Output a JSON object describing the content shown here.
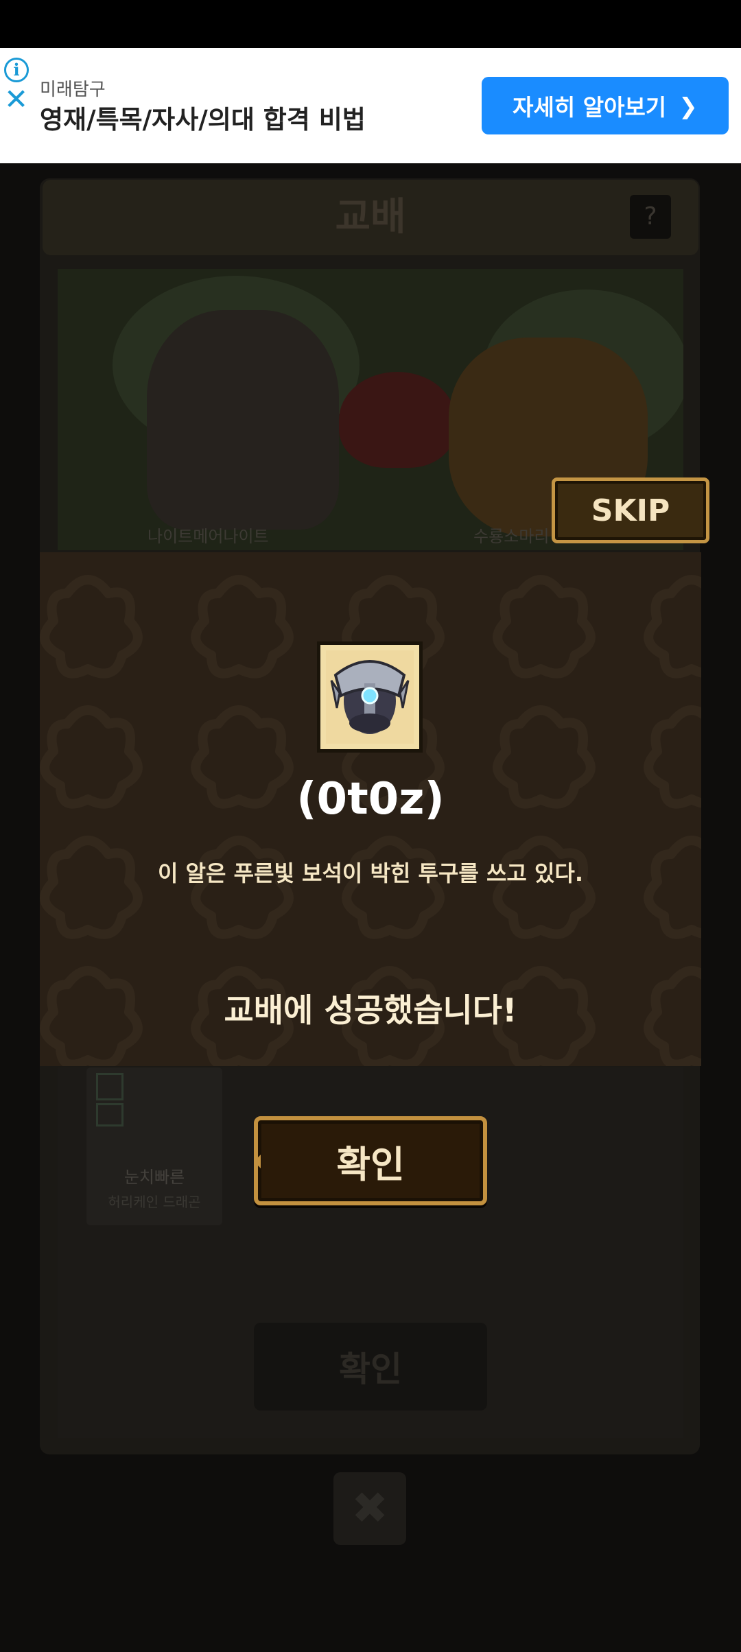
{
  "ad": {
    "sponsor": "미래탐구",
    "headline": "영재/특목/자사/의대 합격 비법",
    "cta": "자세히 알아보기",
    "info_icon": "info-icon",
    "close_icon": "close-icon"
  },
  "background": {
    "title": "교배",
    "help": "?",
    "parent1": "나이트메어나이트",
    "parent2": "수룡소마리",
    "child_name": "눈치빠른",
    "child_type": "허리케인 드래곤",
    "confirm_disabled": "확인",
    "close": "✖"
  },
  "skip": "SKIP",
  "modal": {
    "item_icon": "armored-egg-icon",
    "egg_name": "(0t0z)",
    "description": "이 알은 푸른빛 보석이 박힌 투구를 쓰고 있다.",
    "result": "교배에 성공했습니다!"
  },
  "confirm": "확인",
  "colors": {
    "ad_button": "#1a8cff",
    "modal_bg": "#2a2016",
    "gold_border": "#c3913f",
    "text_cream": "#f6e7c4"
  }
}
